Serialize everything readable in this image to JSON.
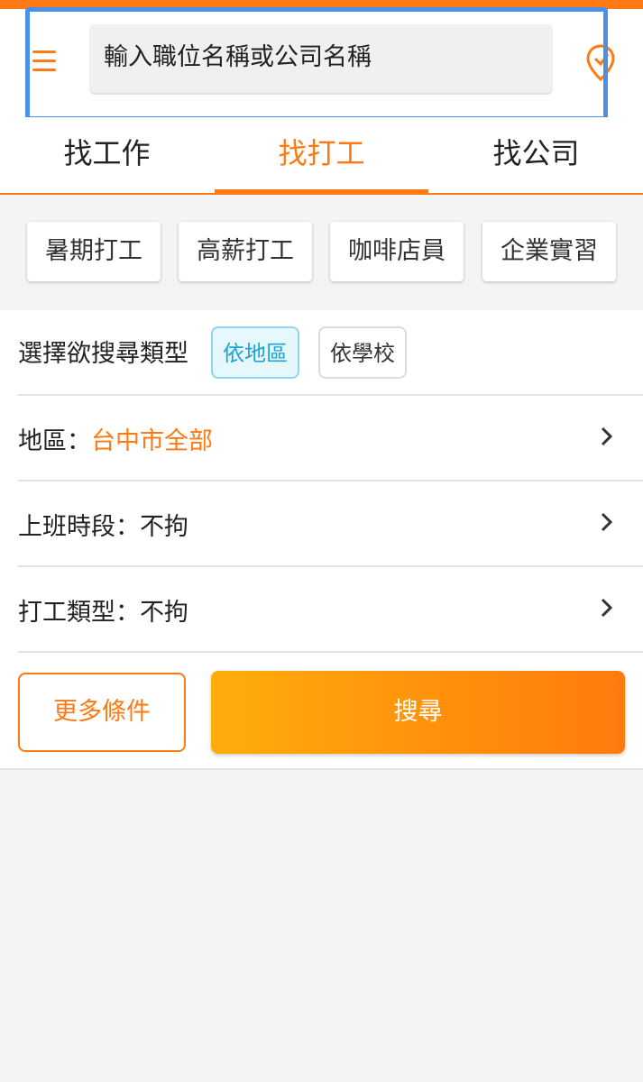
{
  "header": {
    "search_placeholder": "輸入職位名稱或公司名稱"
  },
  "tabs": [
    {
      "label": "找工作"
    },
    {
      "label": "找打工"
    },
    {
      "label": "找公司"
    }
  ],
  "quick_tags": [
    {
      "label": "暑期打工"
    },
    {
      "label": "高薪打工"
    },
    {
      "label": "咖啡店員"
    },
    {
      "label": "企業實習"
    }
  ],
  "search_type": {
    "label": "選擇欲搜尋類型",
    "options": [
      {
        "label": "依地區"
      },
      {
        "label": "依學校"
      }
    ]
  },
  "filters": [
    {
      "label": "地區：",
      "value": "台中市全部"
    },
    {
      "label": "上班時段：",
      "value": "不拘"
    },
    {
      "label": "打工類型：",
      "value": "不拘"
    }
  ],
  "actions": {
    "more_label": "更多條件",
    "search_label": "搜尋"
  },
  "colors": {
    "accent": "#ff7a14",
    "active_type": "#1fa3d6",
    "highlight": "#4a90e8"
  }
}
